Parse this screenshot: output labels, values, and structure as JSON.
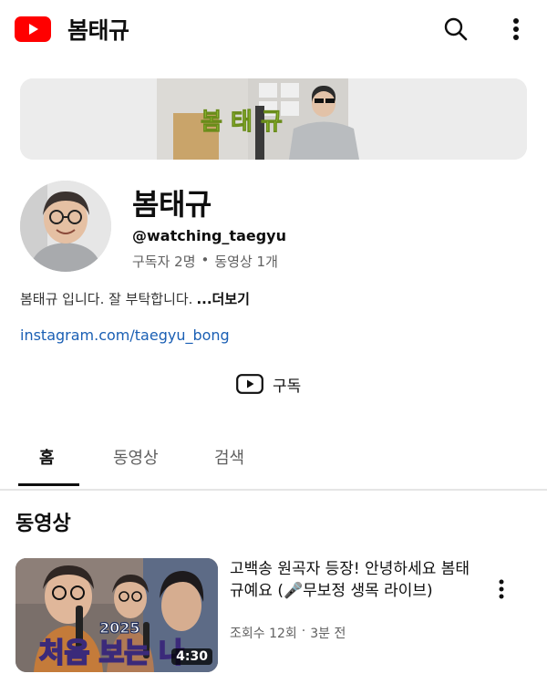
{
  "header": {
    "title": "봄태규",
    "logo_icon": "youtube-logo",
    "search_icon": "search-icon",
    "more_icon": "more-vert-icon"
  },
  "banner": {
    "overlay_text": "봄 태 규"
  },
  "channel": {
    "name": "봄태규",
    "handle": "@watching_taegyu",
    "subscribers": "구독자 2명",
    "separator": "•",
    "video_count": "동영상 1개",
    "description": "봄태규 입니다. 잘 부탁합니다.",
    "more_label": "...더보기",
    "link": "instagram.com/taegyu_bong"
  },
  "subscribe": {
    "label": "구독",
    "icon": "youtube-play-icon"
  },
  "tabs": [
    {
      "label": "홈",
      "active": true
    },
    {
      "label": "동영상",
      "active": false
    },
    {
      "label": "검색",
      "active": false
    }
  ],
  "section": {
    "title": "동영상"
  },
  "video": {
    "title": "고백송 원곡자 등장! 안녕하세요 봄태규예요 (🎤무보정 생목 라이브)",
    "views": "조회수 12회",
    "separator": "·",
    "age": "3분 전",
    "duration": "4:30",
    "thumb_year": "2025",
    "thumb_caption": "처음 보는 나"
  },
  "colors": {
    "brand_red": "#ff0000",
    "link_blue": "#1a5fb4",
    "muted_text": "#606060"
  }
}
